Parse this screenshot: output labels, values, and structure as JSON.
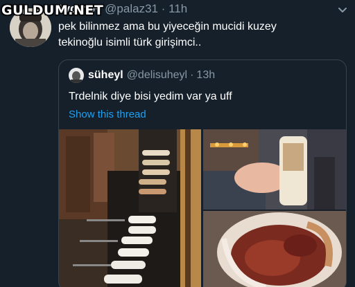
{
  "watermark": "GULDUM.NET",
  "tweet": {
    "author_name": "Aydınov",
    "author_handle": "@palaz31",
    "separator": "·",
    "time": "11h",
    "text_line1": "pek bilinmez ama bu yiyeceğin mucidi kuzey",
    "text_line2": "tekinoğlu isimli türk girişimci.."
  },
  "quoted": {
    "author_name": "süheyl",
    "author_handle": "@delisuheyl",
    "separator": "·",
    "time": "13h",
    "text": "Trdelnik diye bisi yedim var ya uff",
    "show_thread": "Show this thread"
  },
  "icons": {
    "menu": "chevron-down-icon"
  },
  "colors": {
    "background": "#15202b",
    "secondary_text": "#8899a6",
    "link": "#1da1f2",
    "border": "#38444d"
  }
}
